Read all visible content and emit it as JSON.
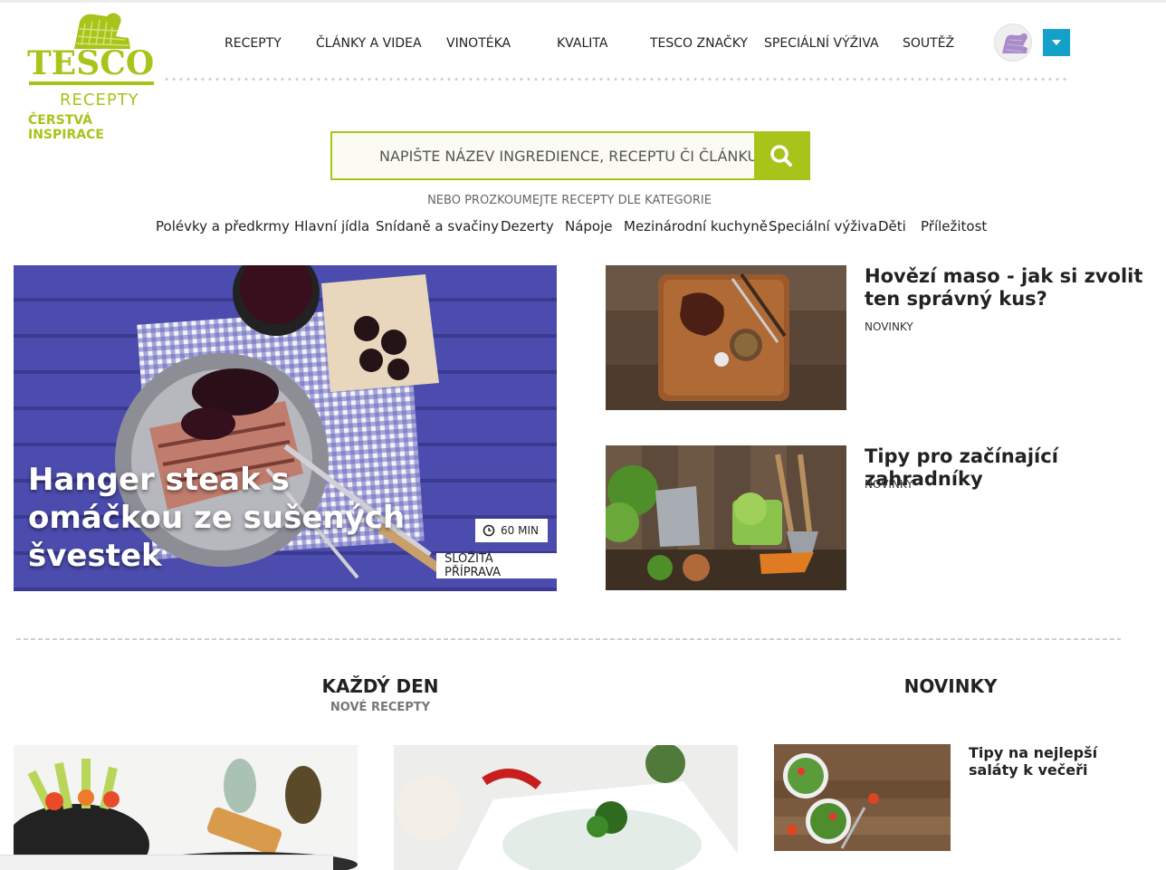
{
  "logo": {
    "brand": "TESCO",
    "sub": "RECEPTY",
    "tagline": "ČERSTVÁ INSPIRACE"
  },
  "nav": {
    "items": [
      "RECEPTY",
      "ČLÁNKY A VIDEA",
      "VINOTÉKA",
      "KVALITA",
      "TESCO ZNAČKY",
      "SPECIÁLNÍ VÝŽIVA",
      "SOUTĚŽ"
    ]
  },
  "user": {
    "avatar_icon": "oven-mitt-icon",
    "dropdown_icon": "caret-down-icon"
  },
  "search": {
    "placeholder": "NAPIŠTE NÁZEV INGREDIENCE, RECEPTU ČI ČLÁNKU",
    "button_icon": "search-icon"
  },
  "categories": {
    "prompt": "NEBO PROZKOUMEJTE RECEPTY DLE KATEGORIE",
    "items": [
      "Polévky a předkrmy",
      "Hlavní jídla",
      "Snídaně a svačiny",
      "Dezerty",
      "Nápoje",
      "Mezinárodní kuchyně",
      "Speciální výživa",
      "Děti",
      "Příležitost"
    ]
  },
  "hero": {
    "title": "Hanger steak s omáčkou ze sušených švestek",
    "time": "60 MIN",
    "difficulty": "SLOŽITÁ PŘÍPRAVA"
  },
  "articles": [
    {
      "title": "Hovězí maso - jak si zvolit ten správný kus?",
      "label": "NOVINKY"
    },
    {
      "title": "Tipy pro začínající zahradníky",
      "label": "NOVINKY"
    }
  ],
  "sections": {
    "daily_title": "KAŽDÝ DEN",
    "daily_sub": "NOVÉ RECEPTY",
    "news_title": "NOVINKY"
  },
  "news_item": {
    "title": "Tipy na nejlepší saláty k večeři"
  },
  "colors": {
    "accent": "#a8c41a",
    "dropdown": "#13a0c9"
  }
}
